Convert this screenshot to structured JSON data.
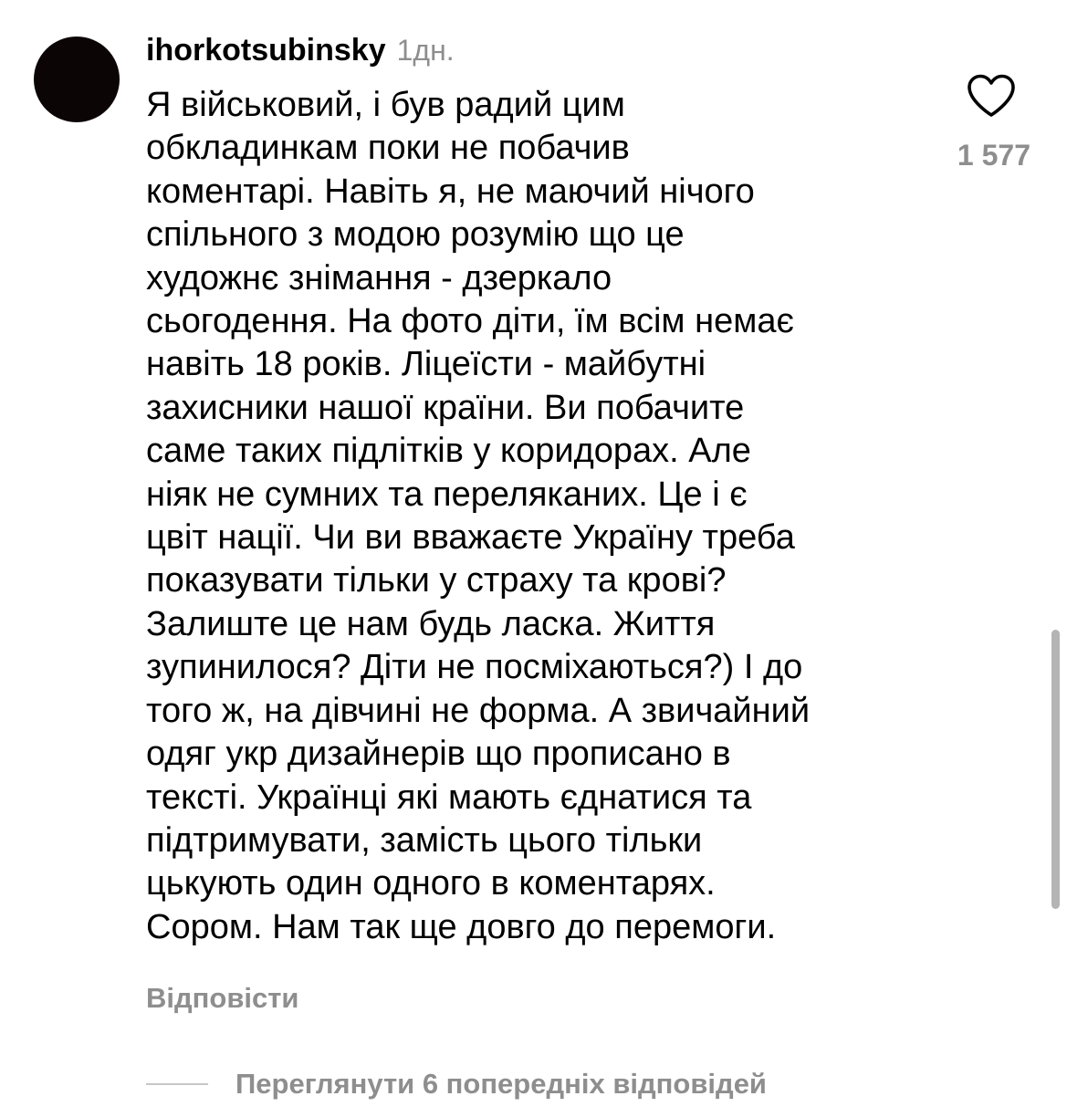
{
  "comment": {
    "username": "ihorkotsubinsky",
    "time": "1дн.",
    "text": "Я військовий, і був радий цим\nобкладинкам поки не побачив\nкоментарі. Навіть я, не маючий нічого\nспільного з модою розумію що це\nхудожнє знімання - дзеркало\nсьогодення. На фото діти, їм всім немає\nнавіть 18 років. Ліцеїсти - майбутні\nзахисники нашої країни. Ви побачите\nсаме таких підлітків у коридорах. Але\nніяк не сумних та переляканих. Це і є\nцвіт нації. Чи ви вважаєте Україну треба\nпоказувати тільки у страху та крові?\nЗалиште це нам будь ласка. Життя\nзупинилося? Діти не посміхаються?) І до\nтого ж, на дівчині не форма. А звичайний\nодяг укр дизайнерів що прописано в\nтексті. Українці які мають єднатися та\nпідтримувати, замість цього тільки\nцькують один одного в коментарях.\nСором. Нам так ще довго до перемоги.",
    "like_count": "1 577",
    "reply_label": "Відповісти"
  },
  "replies": {
    "view_label": "Переглянути 6 попередніх відповідей"
  },
  "icons": {
    "like": "heart-outline-icon"
  },
  "colors": {
    "text": "#000000",
    "secondary": "#8e8e8e",
    "avatar": "#0c0506",
    "divider": "#c7c7c7",
    "scrollbar": "#b4b4b4"
  }
}
